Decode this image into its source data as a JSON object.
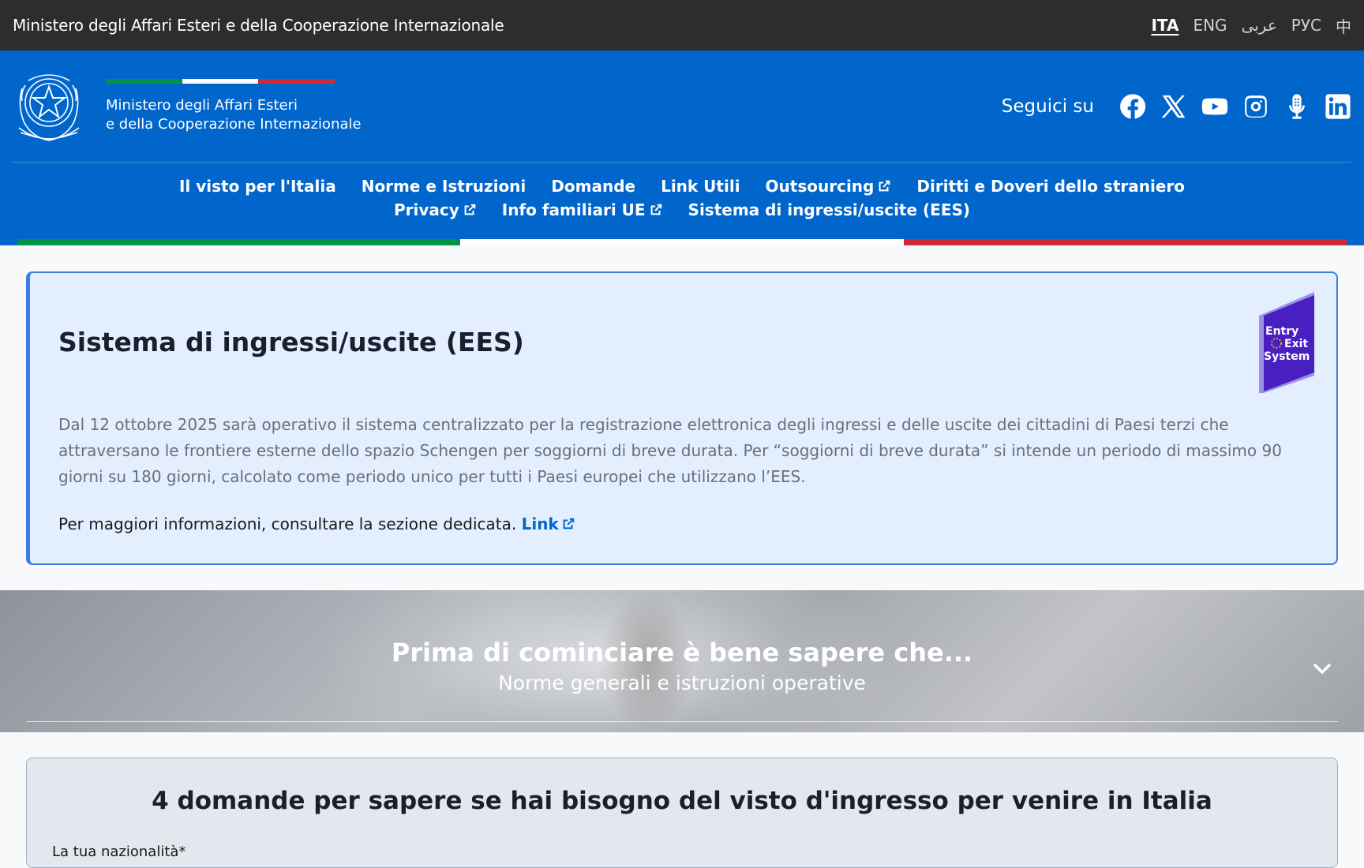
{
  "topbar": {
    "title": "Ministero degli Affari Esteri e della Cooperazione Internazionale",
    "languages": [
      "ITA",
      "ENG",
      "عربى",
      "РУС",
      "中"
    ]
  },
  "header": {
    "brand_line1": "Ministero degli Affari Esteri",
    "brand_line2": "e della Cooperazione Internazionale",
    "follow_label": "Seguici su",
    "social_icons": [
      "facebook-icon",
      "x-icon",
      "youtube-icon",
      "instagram-icon",
      "microphone-icon",
      "linkedin-icon"
    ]
  },
  "nav": {
    "items": [
      {
        "label": "Il visto per l'Italia"
      },
      {
        "label": "Norme e Istruzioni"
      },
      {
        "label": "Domande"
      },
      {
        "label": "Link Utili"
      },
      {
        "label": "Outsourcing"
      },
      {
        "label": "Diritti e Doveri dello straniero"
      },
      {
        "label": "Privacy"
      },
      {
        "label": "Info familiari UE"
      },
      {
        "label": "Sistema di ingressi/uscite (EES)"
      }
    ]
  },
  "info_card": {
    "title": "Sistema di ingressi/uscite (EES)",
    "body": "Dal 12 ottobre 2025 sarà operativo il sistema centralizzato per la registrazione elettronica degli ingressi e delle uscite dei cittadini di Paesi terzi che attraversano le frontiere esterne dello spazio Schengen per soggiorni di breve durata. Per “soggiorni di breve durata” si intende un periodo di massimo 90 giorni su 180 giorni, calcolato come periodo unico per tutti i Paesi europei che utilizzano l’EES.",
    "more_text": "Per maggiori informazioni, consultare la sezione dedicata.",
    "link_label": "Link",
    "badge_line1": "Entry",
    "badge_line2": "Exit",
    "badge_line3": "System"
  },
  "banner": {
    "title": "Prima di cominciare è bene sapere che...",
    "subtitle": "Norme generali e istruzioni operative"
  },
  "questions": {
    "title": "4 domande per sapere se hai bisogno del visto d'ingresso per venire in Italia",
    "nationality_label": "La tua nazionalità*"
  },
  "colors": {
    "topbar": "#2d2d2d",
    "header_blue": "#0066cc",
    "flag_green": "#009246",
    "flag_white": "#ffffff",
    "flag_red": "#ce2b37",
    "card_border": "#3b7de0",
    "ees_purple": "#4a1fc2"
  }
}
